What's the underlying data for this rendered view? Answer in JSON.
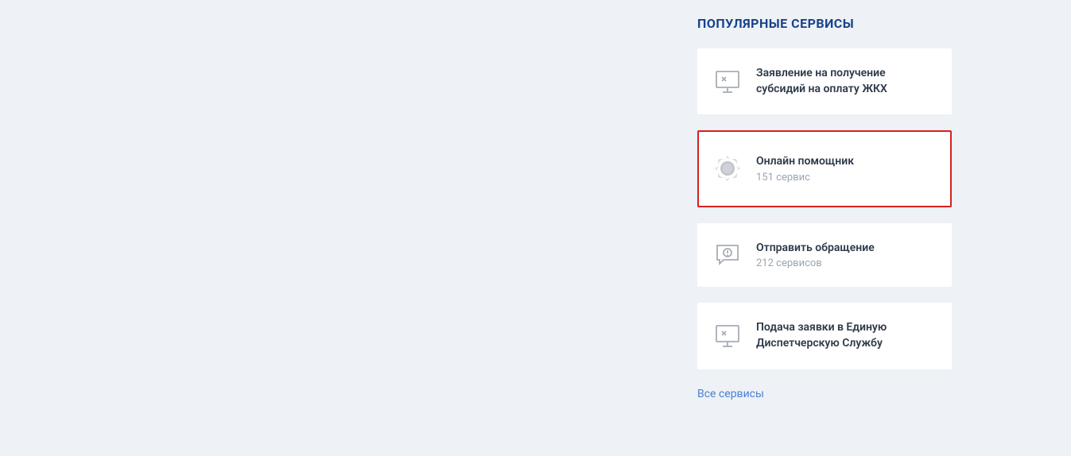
{
  "popular_services": {
    "heading": "ПОПУЛЯРНЫЕ СЕРВИСЫ",
    "cards": [
      {
        "title": "Заявление на получение субсидий на оплату ЖКХ",
        "subtitle": ""
      },
      {
        "title": "Онлайн помощник",
        "subtitle": "151 сервис"
      },
      {
        "title": "Отправить обращение",
        "subtitle": "212 сервисов"
      },
      {
        "title": "Подача заявки в Единую Диспетчерскую Службу",
        "subtitle": ""
      }
    ],
    "all_link": "Все сервисы"
  }
}
